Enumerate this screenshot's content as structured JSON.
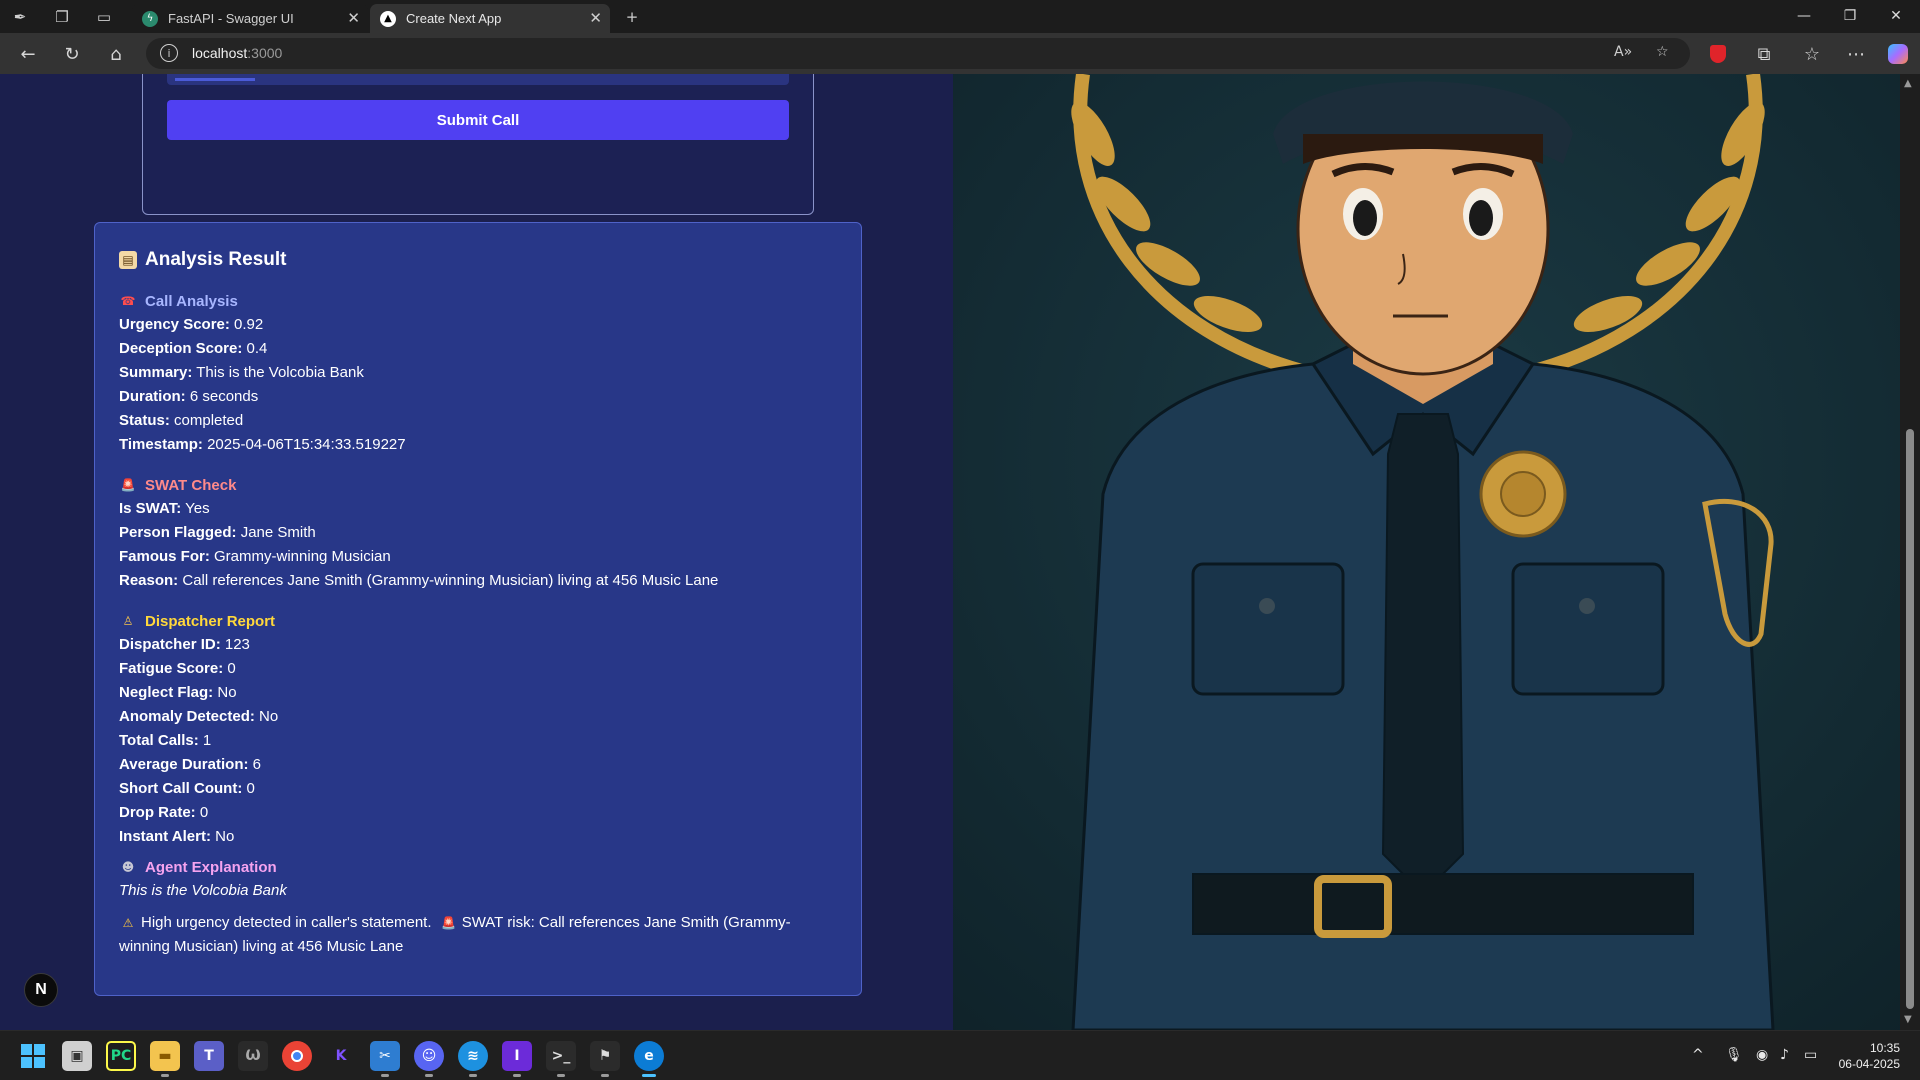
{
  "browser": {
    "tabs": [
      {
        "title": "FastAPI - Swagger UI",
        "active": false
      },
      {
        "title": "Create Next App",
        "active": true
      }
    ],
    "address": {
      "host": "localhost",
      "port": ":3000"
    }
  },
  "form": {
    "submit_label": "Submit Call"
  },
  "result": {
    "title": "Analysis Result",
    "call_analysis": {
      "heading": "Call Analysis",
      "rows": [
        {
          "label": "Urgency Score:",
          "value": "0.92"
        },
        {
          "label": "Deception Score:",
          "value": "0.4"
        },
        {
          "label": "Summary:",
          "value": "This is the Volcobia Bank"
        },
        {
          "label": "Duration:",
          "value": "6 seconds"
        },
        {
          "label": "Status:",
          "value": "completed"
        },
        {
          "label": "Timestamp:",
          "value": "2025-04-06T15:34:33.519227"
        }
      ]
    },
    "swat_check": {
      "heading": "SWAT Check",
      "rows": [
        {
          "label": "Is SWAT:",
          "value": "Yes"
        },
        {
          "label": "Person Flagged:",
          "value": "Jane Smith"
        },
        {
          "label": "Famous For:",
          "value": "Grammy-winning Musician"
        },
        {
          "label": "Reason:",
          "value": "Call references Jane Smith (Grammy-winning Musician) living at 456 Music Lane"
        }
      ]
    },
    "dispatcher_report": {
      "heading": "Dispatcher Report",
      "rows": [
        {
          "label": "Dispatcher ID:",
          "value": "123"
        },
        {
          "label": "Fatigue Score:",
          "value": "0"
        },
        {
          "label": "Neglect Flag:",
          "value": "No"
        },
        {
          "label": "Anomaly Detected:",
          "value": "No"
        },
        {
          "label": "Total Calls:",
          "value": "1"
        },
        {
          "label": "Average Duration:",
          "value": "6"
        },
        {
          "label": "Short Call Count:",
          "value": "0"
        },
        {
          "label": "Drop Rate:",
          "value": "0"
        },
        {
          "label": "Instant Alert:",
          "value": "No"
        }
      ]
    },
    "agent_explanation": {
      "heading": "Agent Explanation",
      "summary": "This is the Volcobia Bank",
      "note_part1": "High urgency detected in caller's statement.",
      "note_part2": "SWAT risk: Call references Jane Smith (Grammy-winning Musician) living at 456 Music Lane"
    }
  },
  "colors": {
    "page_bg": "#1b1f4d",
    "card_bg": "#283788",
    "submit": "#5040f2",
    "call_heading": "#a8b6ff",
    "swat_heading": "#ff8a8a",
    "dispatcher_heading": "#ffd83b",
    "agent_heading": "#f5a3ef"
  },
  "next_badge": "N",
  "taskbar": {
    "time": "10:35",
    "date": "06-04-2025"
  }
}
